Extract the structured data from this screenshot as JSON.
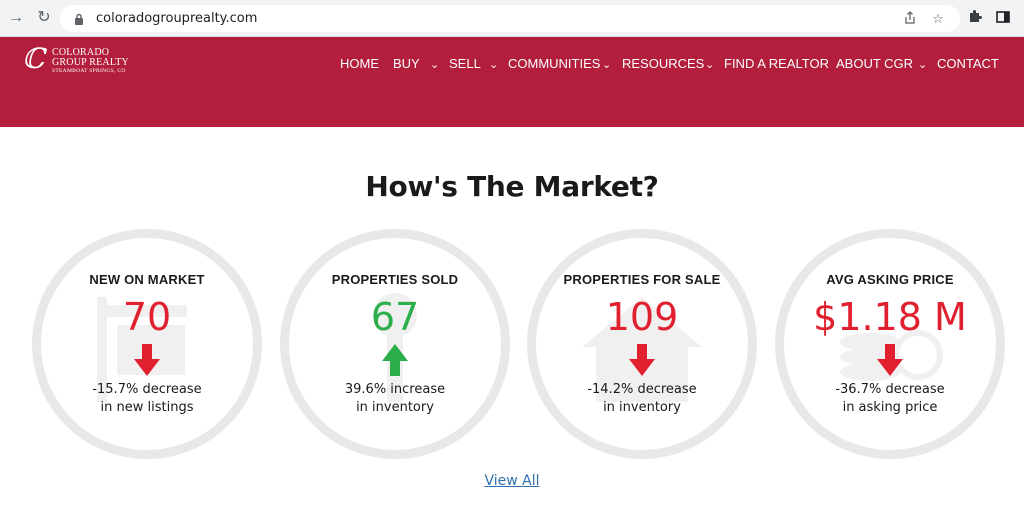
{
  "browser": {
    "url": "coloradogrouprealty.com",
    "icons": [
      "back-arrow-icon",
      "reload-icon",
      "lock-icon",
      "share-icon",
      "star-icon",
      "extensions-icon",
      "sidebar-icon"
    ]
  },
  "brand": {
    "line1": "COLORADO",
    "line2": "GROUP REALTY",
    "line3": "STEAMBOAT SPRINGS, CO",
    "primary_color": "#b21e3b"
  },
  "nav": {
    "home": "HOME",
    "buy": "BUY",
    "sell": "SELL",
    "communities": "COMMUNITIES",
    "resources": "RESOURCES",
    "find_realtor": "FIND A REALTOR",
    "about": "ABOUT CGR",
    "contact": "CONTACT"
  },
  "market": {
    "title": "How's The Market?",
    "stats": [
      {
        "label": "NEW ON MARKET",
        "value": "70",
        "direction": "down",
        "desc1": "-15.7% decrease",
        "desc2": "in new listings",
        "color": "#e0202e"
      },
      {
        "label": "PROPERTIES SOLD",
        "value": "67",
        "direction": "up",
        "desc1": "39.6% increase",
        "desc2": "in inventory",
        "color": "#2cae4a"
      },
      {
        "label": "PROPERTIES FOR SALE",
        "value": "109",
        "direction": "down",
        "desc1": "-14.2% decrease",
        "desc2": "in inventory",
        "color": "#e0202e"
      },
      {
        "label": "AVG ASKING PRICE",
        "value": "$1.18 M",
        "direction": "down",
        "desc1": "-36.7% decrease",
        "desc2": "in asking price",
        "color": "#e0202e"
      }
    ],
    "view_all": "View All"
  }
}
